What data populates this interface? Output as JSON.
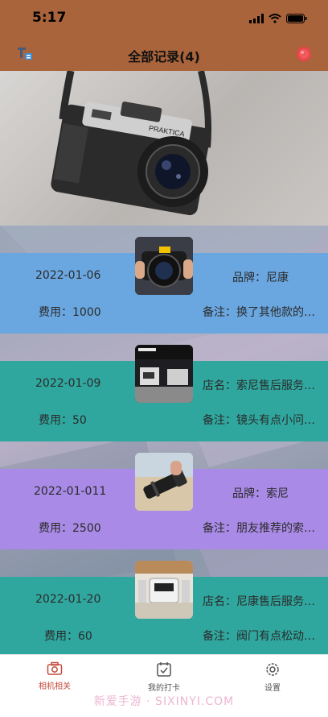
{
  "status": {
    "time": "5:17"
  },
  "nav": {
    "title": "全部记录(4)"
  },
  "records": [
    {
      "date": "2022-01-06",
      "left_top": "2022-01-06",
      "right_top": "品牌：尼康",
      "left_bottom": "费用：1000",
      "right_bottom": "备注：换了其他款的…",
      "bg": "#6aa7e0"
    },
    {
      "date": "2022-01-09",
      "left_top": "2022-01-09",
      "right_top": "店名：索尼售后服务…",
      "left_bottom": "费用：50",
      "right_bottom": "备注：镜头有点小问…",
      "bg": "#2fa79e"
    },
    {
      "date": "2022-01-011",
      "left_top": "2022-01-011",
      "right_top": "品牌：索尼",
      "left_bottom": "费用：2500",
      "right_bottom": "备注：朋友推荐的索…",
      "bg": "#a98ae6"
    },
    {
      "date": "2022-01-20",
      "left_top": "2022-01-20",
      "right_top": "店名：尼康售后服务…",
      "left_bottom": "费用：60",
      "right_bottom": "备注：阀门有点松动…",
      "bg": "#2fa79e"
    }
  ],
  "tabs": [
    {
      "label": "相机相关",
      "icon": "camera-icon",
      "active": true
    },
    {
      "label": "我的打卡",
      "icon": "checkin-icon",
      "active": false
    },
    {
      "label": "设置",
      "icon": "settings-gear-icon",
      "active": false
    }
  ],
  "watermark": "新爱手游 · SIXINYI.COM",
  "colors": {
    "header": "#a9643b",
    "active_tab": "#c24a3a"
  }
}
